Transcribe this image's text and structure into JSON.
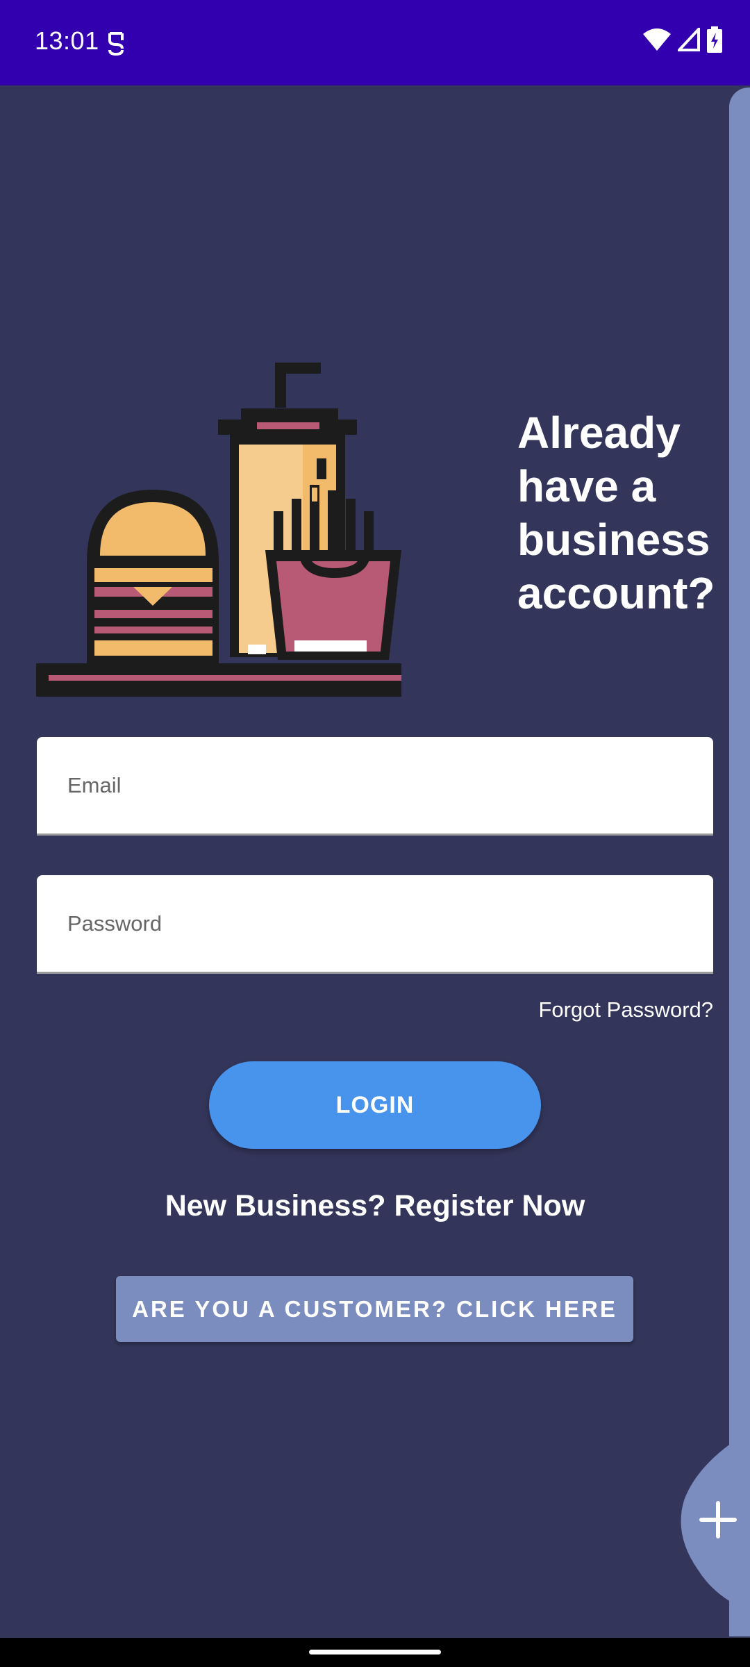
{
  "status_bar": {
    "time": "13:01",
    "icons": [
      "sim-icon",
      "wifi-icon",
      "signal-icon",
      "battery-charging-icon"
    ]
  },
  "illustration": {
    "icon": "fast-food-illustration-icon"
  },
  "headline": "Already have a business account?",
  "email": {
    "placeholder": "Email",
    "value": ""
  },
  "password": {
    "placeholder": "Password",
    "value": ""
  },
  "forgot_label": "Forgot Password?",
  "login_label": "LOGIN",
  "register_label": "New Business? Register Now",
  "customer_label": "ARE YOU A CUSTOMER? CLICK HERE",
  "fab": {
    "icon": "plus-icon"
  },
  "colors": {
    "background": "#33355a",
    "status_bar": "#3300b0",
    "accent": "#4893ec",
    "secondary": "#7b8cbf"
  }
}
